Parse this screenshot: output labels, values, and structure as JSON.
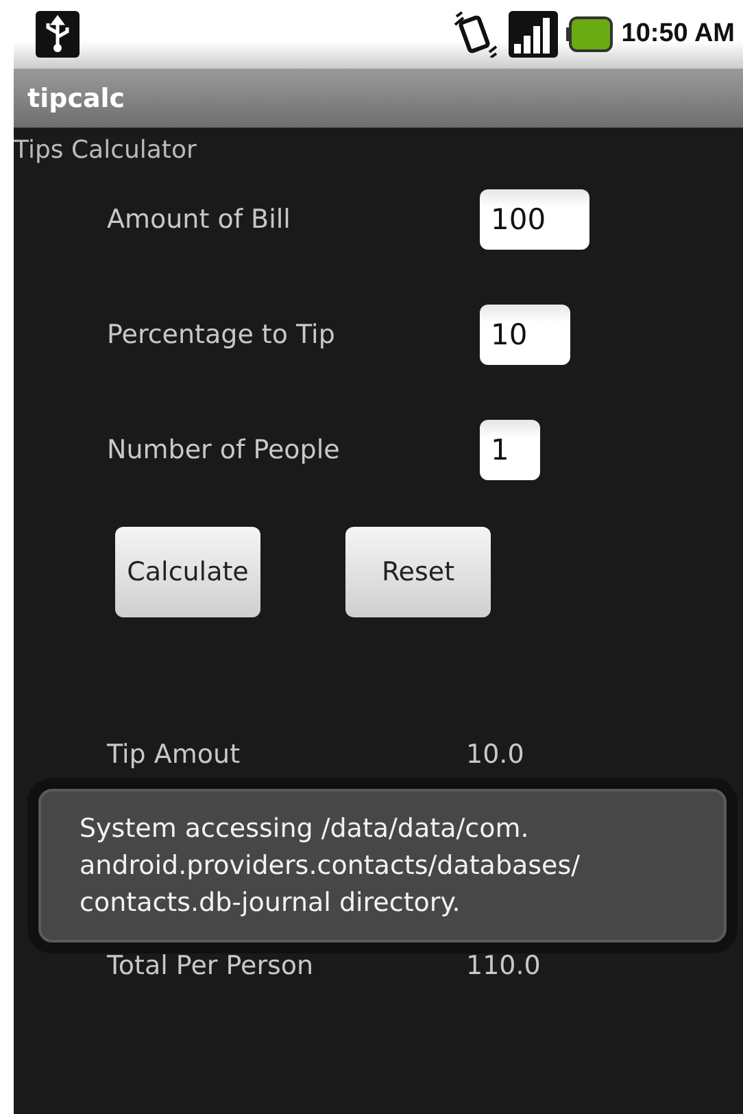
{
  "status_bar": {
    "time": "10:50 AM"
  },
  "app_bar": {
    "title": "tipcalc"
  },
  "heading": "Tips Calculator",
  "inputs": [
    {
      "label": "Amount of Bill",
      "value": "100"
    },
    {
      "label": "Percentage to Tip",
      "value": "10"
    },
    {
      "label": "Number of People",
      "value": "1"
    }
  ],
  "buttons": [
    "Calculate",
    "Reset"
  ],
  "results": [
    {
      "label": "Tip Amout",
      "value": "10.0"
    },
    {
      "label": "Total Per Person",
      "value": "110.0"
    }
  ],
  "toast": "System accessing /data/data/com.\nandroid.providers.contacts/databases/\ncontacts.db-journal directory."
}
